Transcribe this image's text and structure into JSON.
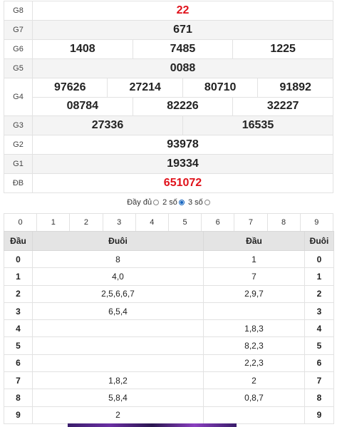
{
  "prizes": {
    "g8": {
      "label": "G8",
      "values": [
        "22"
      ]
    },
    "g7": {
      "label": "G7",
      "values": [
        "671"
      ]
    },
    "g6": {
      "label": "G6",
      "values": [
        "1408",
        "7485",
        "1225"
      ]
    },
    "g5": {
      "label": "G5",
      "values": [
        "0088"
      ]
    },
    "g4": {
      "label": "G4",
      "values": [
        "97626",
        "27214",
        "80710",
        "91892",
        "08784",
        "82226",
        "32227"
      ]
    },
    "g3": {
      "label": "G3",
      "values": [
        "27336",
        "16535"
      ]
    },
    "g2": {
      "label": "G2",
      "values": [
        "93978"
      ]
    },
    "g1": {
      "label": "G1",
      "values": [
        "19334"
      ]
    },
    "db": {
      "label": "ĐB",
      "values": [
        "651072"
      ]
    }
  },
  "colors": {
    "special": "#e0121b",
    "radio_selected": "#1565c0"
  },
  "options": {
    "full": "Đầy đủ",
    "two_digit": "2 số",
    "three_digit": "3 số",
    "selected": "2 số"
  },
  "digits": [
    "0",
    "1",
    "2",
    "3",
    "4",
    "5",
    "6",
    "7",
    "8",
    "9"
  ],
  "loto": {
    "headers": [
      "Đầu",
      "Đuôi",
      "Đầu",
      "Đuôi"
    ],
    "rows": [
      {
        "head": "0",
        "tails": "8",
        "heads": "1",
        "tail": "0"
      },
      {
        "head": "1",
        "tails": "4,0",
        "heads": "7",
        "tail": "1"
      },
      {
        "head": "2",
        "tails": "2,5,6,6,7",
        "heads": "2,9,7",
        "tail": "2"
      },
      {
        "head": "3",
        "tails": "6,5,4",
        "heads": "",
        "tail": "3"
      },
      {
        "head": "4",
        "tails": "",
        "heads": "1,8,3",
        "tail": "4"
      },
      {
        "head": "5",
        "tails": "",
        "heads": "8,2,3",
        "tail": "5"
      },
      {
        "head": "6",
        "tails": "",
        "heads": "2,2,3",
        "tail": "6"
      },
      {
        "head": "7",
        "tails": "1,8,2",
        "heads": "2",
        "tail": "7"
      },
      {
        "head": "8",
        "tails": "5,8,4",
        "heads": "0,8,7",
        "tail": "8"
      },
      {
        "head": "9",
        "tails": "2",
        "heads": "",
        "tail": "9"
      }
    ]
  }
}
